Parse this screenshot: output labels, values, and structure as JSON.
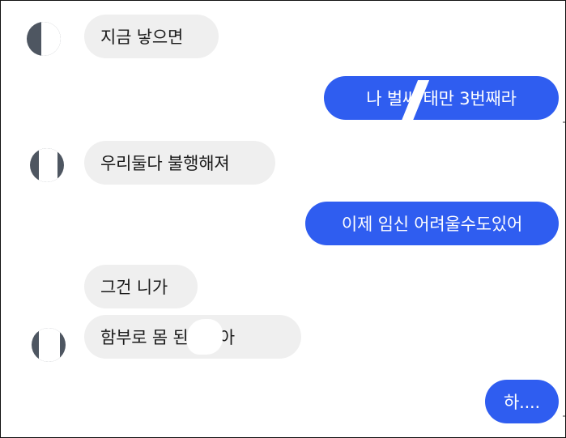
{
  "messages": [
    {
      "side": "received",
      "text": "지금 낳으면"
    },
    {
      "side": "sent",
      "text": "나 벌써  태만 3번째라"
    },
    {
      "side": "received",
      "text": "우리둘다 불행해져"
    },
    {
      "side": "sent",
      "text": "이제 임신 어려울수도있어"
    },
    {
      "side": "received",
      "text": "그건 니가"
    },
    {
      "side": "received",
      "text": "함부로 몸   된거잖아"
    },
    {
      "side": "sent",
      "text": "하...."
    }
  ],
  "colors": {
    "sent_bubble": "#2f5df0",
    "received_bubble": "#efefef",
    "background": "#ffffff"
  }
}
